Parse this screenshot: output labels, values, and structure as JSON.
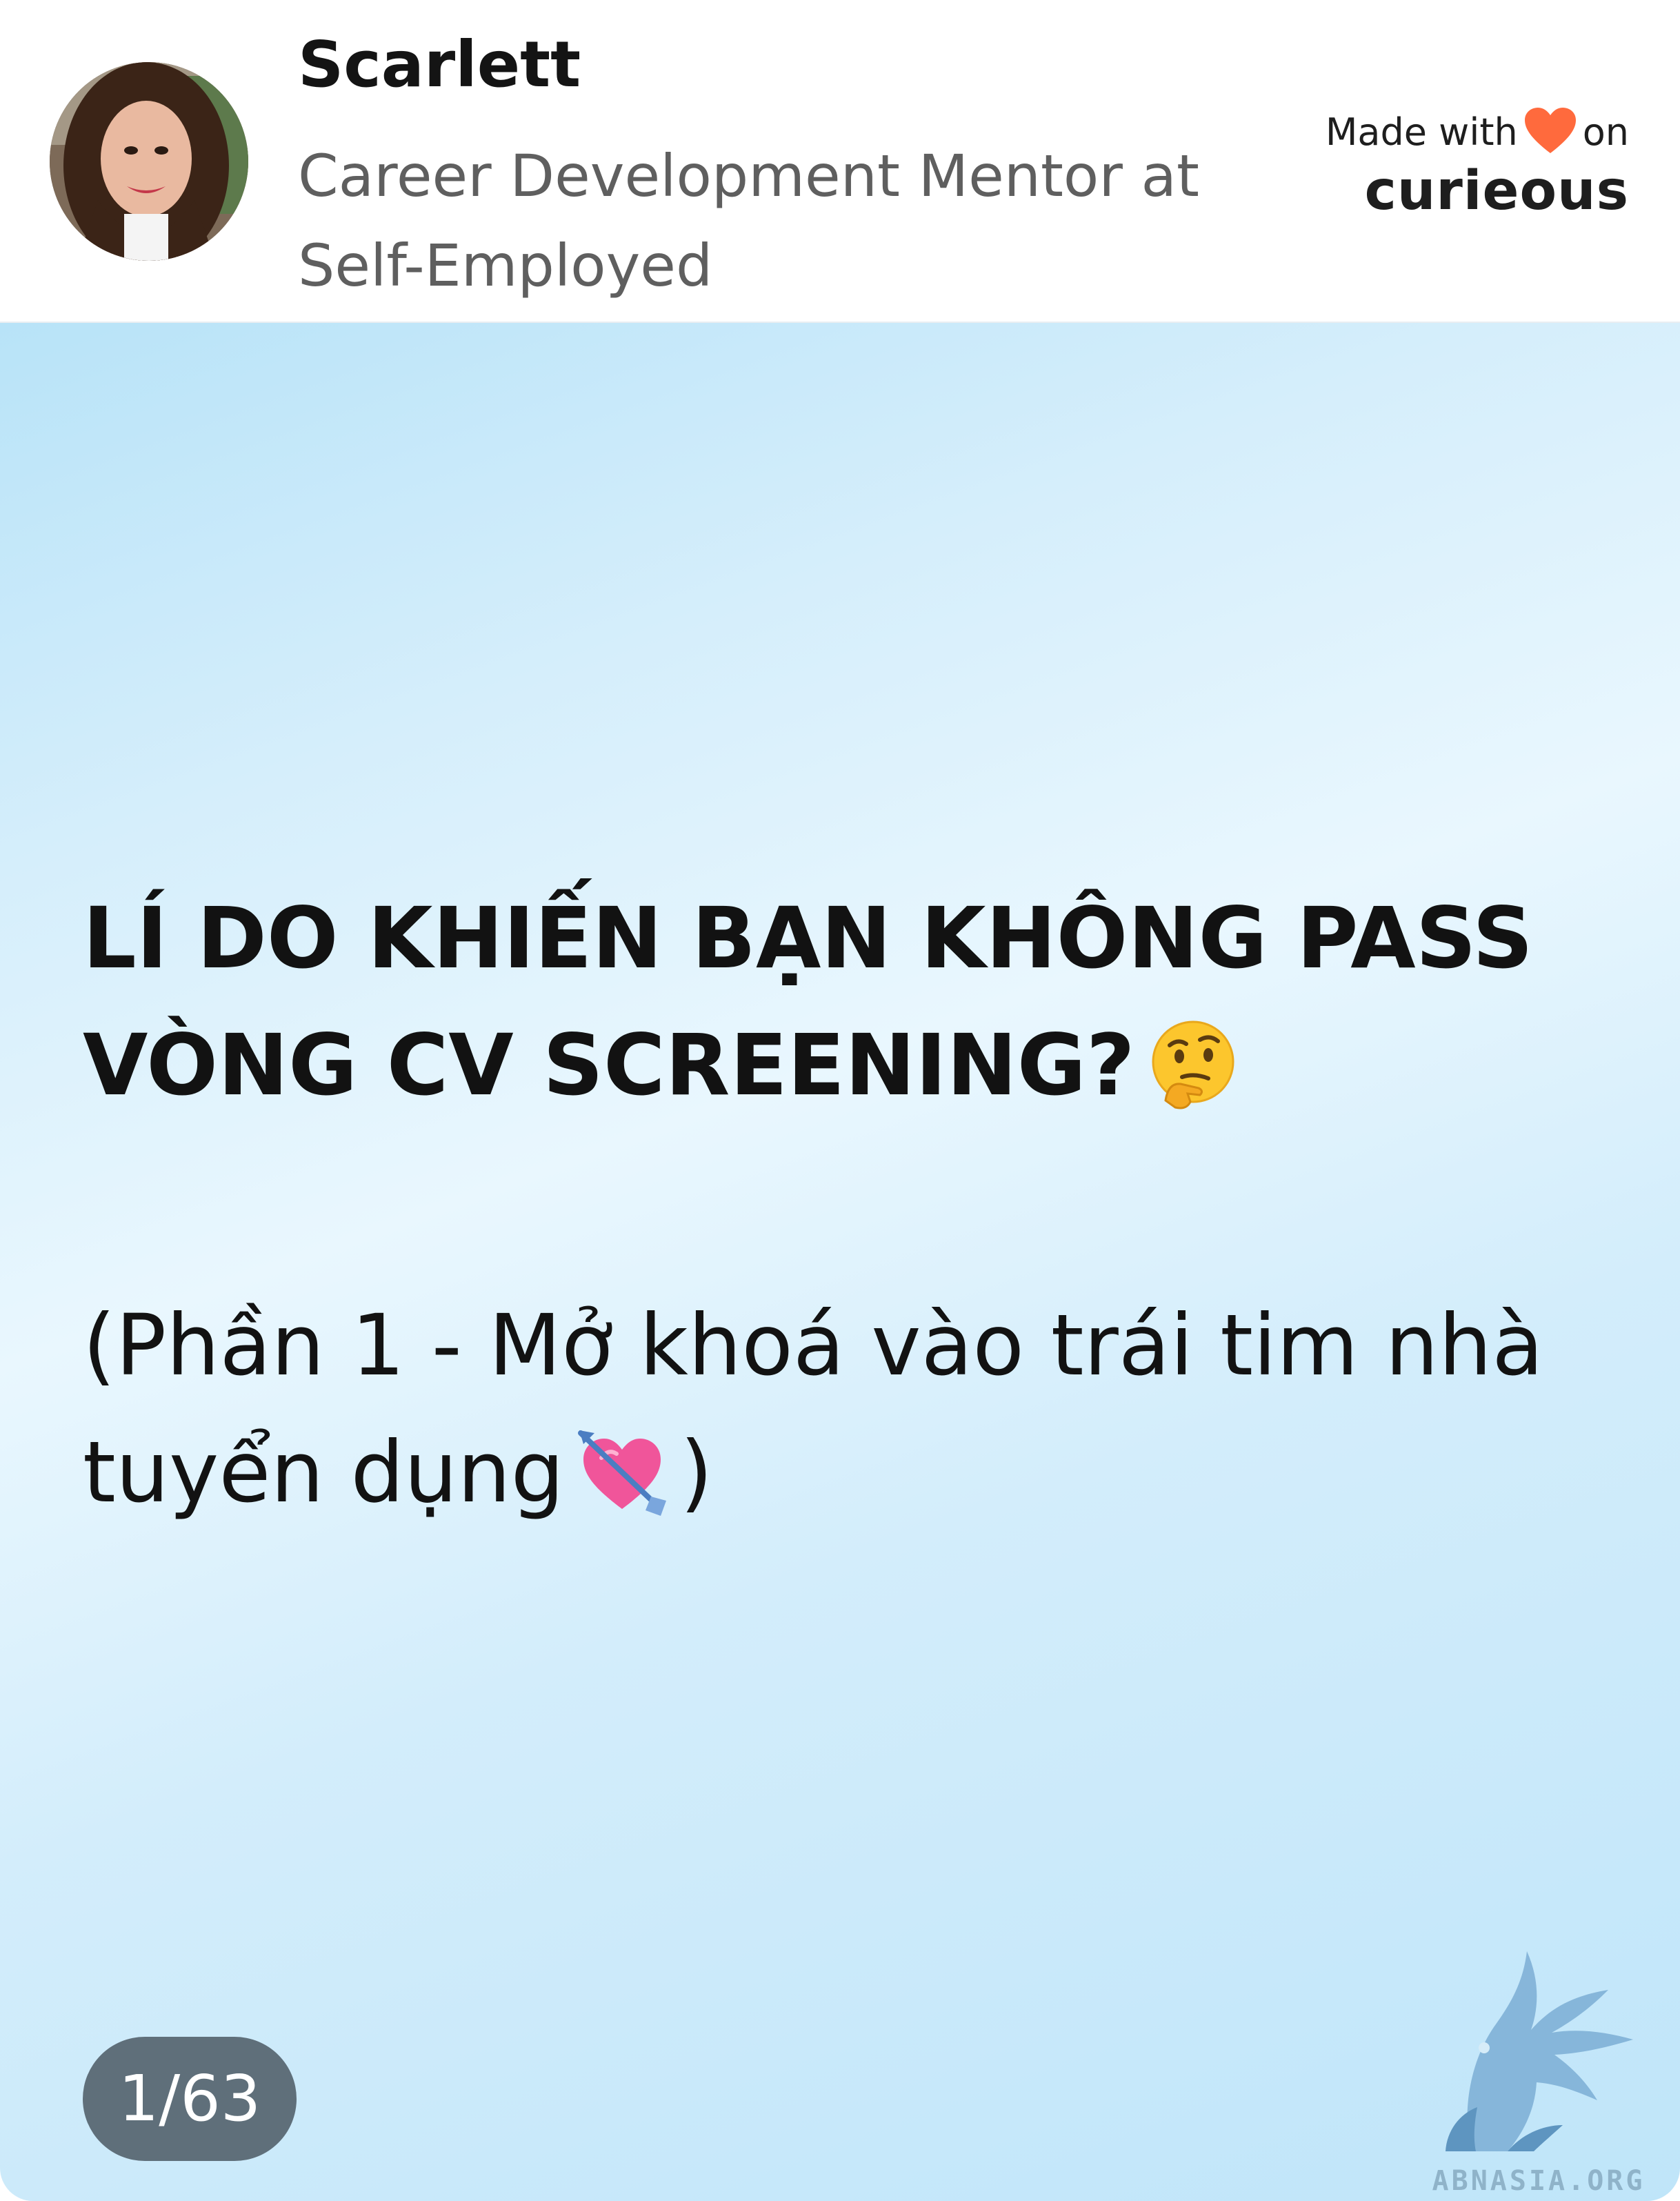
{
  "author": {
    "name": "Scarlett",
    "title": "Career Development Mentor at Self-Employed",
    "avatar_icon": "avatar-photo"
  },
  "brand": {
    "made_with_prefix": "Made with",
    "made_with_suffix": "on",
    "name": "curieous",
    "heart_color": "#ff6a3d"
  },
  "slide": {
    "headline": "LÍ DO KHIẾN BẠN KHÔNG PASS VÒNG CV SCREENING?",
    "headline_emoji": "thinking-face-icon",
    "subline": "(Phần 1 - Mở khoá vào trái tim nhà tuyển dụng",
    "subline_emoji": "heart-with-arrow-icon",
    "subline_close": ")",
    "background_colors": [
      "#b8e3f8",
      "#e9f7fe",
      "#bfe5f9"
    ]
  },
  "pagination": {
    "label": "1/63"
  },
  "watermark": {
    "text": "ABNASIA.ORG",
    "icon": "griffin-logo-icon"
  }
}
